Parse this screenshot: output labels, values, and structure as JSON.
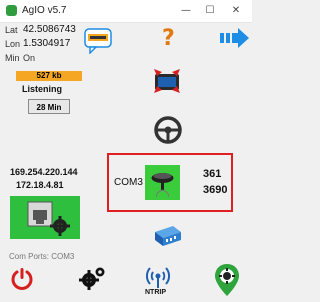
{
  "window": {
    "title": "AgIO v5.7",
    "minimize": "—",
    "maximize": "☐",
    "close": "✕"
  },
  "gps": {
    "lat_label": "Lat",
    "lat_value": "42.5086743",
    "lon_label": "Lon",
    "lon_value": "1.5304917",
    "min_label": "Min",
    "on_label": "On"
  },
  "status": {
    "data_rate": "527 kb",
    "listening": "Listening",
    "time_button": "28 Min"
  },
  "network": {
    "ip1": "169.254.220.144",
    "ip2": "172.18.4.81"
  },
  "ports": {
    "label": "Com Ports:",
    "value": "COM3"
  },
  "gps_port": {
    "name": "COM3",
    "value1": "361",
    "value2": "3690"
  },
  "bottom": {
    "ntrip_label": "NTRIP"
  },
  "colors": {
    "accent_orange": "#f5a623",
    "green": "#2fbf3f",
    "highlight_red": "#e02020",
    "arrow_blue": "#1e8de6"
  }
}
